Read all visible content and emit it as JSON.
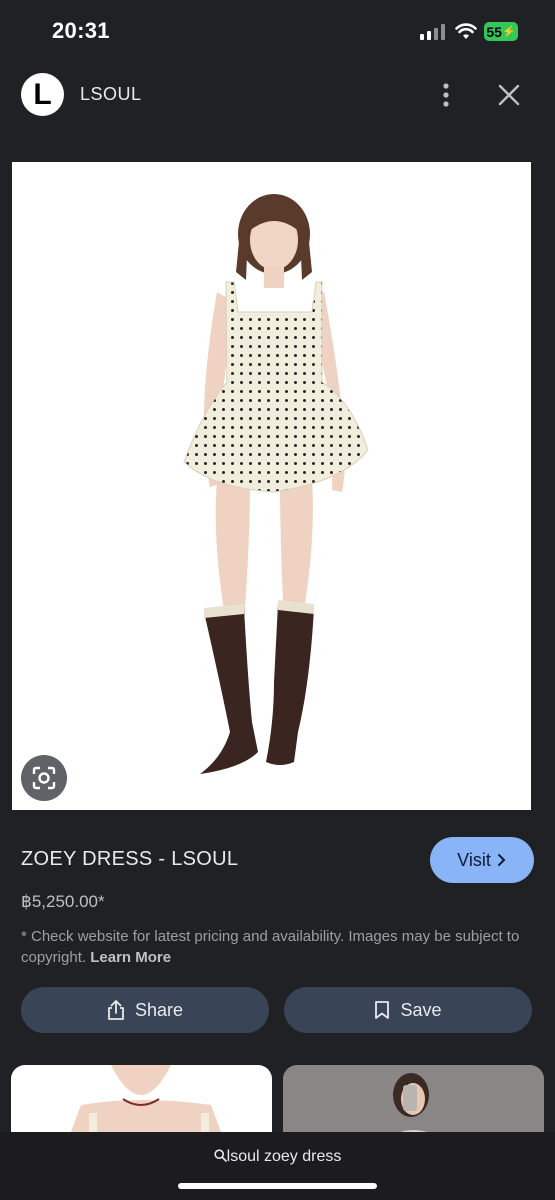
{
  "status_bar": {
    "time": "20:31",
    "battery": "55"
  },
  "header": {
    "logo_letter": "L",
    "brand": "LSOUL"
  },
  "product": {
    "title": "ZOEY DRESS - LSOUL",
    "visit_label": "Visit",
    "price": "฿5,250.00*",
    "disclaimer": "* Check website for latest pricing and availability. Images may be subject to copyright.",
    "learn_more": "Learn More"
  },
  "actions": {
    "share_label": "Share",
    "save_label": "Save"
  },
  "search": {
    "query": "lsoul zoey dress"
  },
  "colors": {
    "accent": "#8ab4f8",
    "button_bg": "#394457",
    "background": "#202124"
  }
}
